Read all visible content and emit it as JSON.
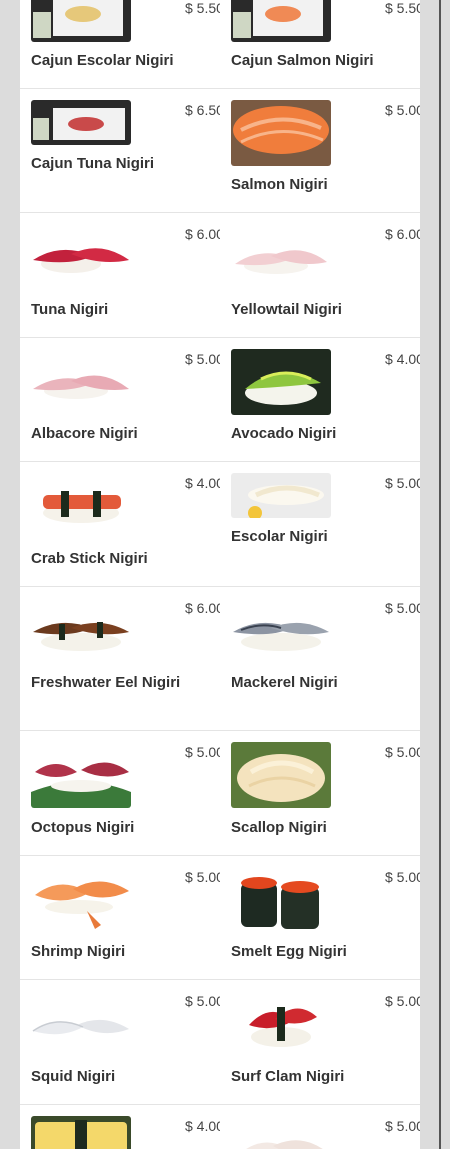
{
  "menu": {
    "items": [
      {
        "name": "Cajun Escolar Nigiri",
        "price": "$ 5.50",
        "image": "cajun-escolar-photo-icon"
      },
      {
        "name": "Cajun Salmon Nigiri",
        "price": "$ 5.50",
        "image": "cajun-salmon-photo-icon"
      },
      {
        "name": "Cajun Tuna Nigiri",
        "price": "$ 6.50",
        "image": "cajun-tuna-photo-icon"
      },
      {
        "name": "Salmon Nigiri",
        "price": "$ 5.00",
        "image": "salmon-photo-icon"
      },
      {
        "name": "Tuna Nigiri",
        "price": "$ 6.00",
        "image": "tuna-photo-icon"
      },
      {
        "name": "Yellowtail Nigiri",
        "price": "$ 6.00",
        "image": "yellowtail-photo-icon"
      },
      {
        "name": "Albacore Nigiri",
        "price": "$ 5.00",
        "image": "albacore-photo-icon"
      },
      {
        "name": "Avocado Nigiri",
        "price": "$ 4.00",
        "image": "avocado-photo-icon"
      },
      {
        "name": "Crab Stick Nigiri",
        "price": "$ 4.00",
        "image": "crab-stick-photo-icon"
      },
      {
        "name": "Escolar Nigiri",
        "price": "$ 5.00",
        "image": "escolar-photo-icon"
      },
      {
        "name": "Freshwater Eel Nigiri",
        "price": "$ 6.00",
        "image": "eel-photo-icon"
      },
      {
        "name": "Mackerel Nigiri",
        "price": "$ 5.00",
        "image": "mackerel-photo-icon"
      },
      {
        "name": "Octopus Nigiri",
        "price": "$ 5.00",
        "image": "octopus-photo-icon"
      },
      {
        "name": "Scallop Nigiri",
        "price": "$ 5.00",
        "image": "scallop-photo-icon"
      },
      {
        "name": "Shrimp Nigiri",
        "price": "$ 5.00",
        "image": "shrimp-photo-icon"
      },
      {
        "name": "Smelt Egg Nigiri",
        "price": "$ 5.00",
        "image": "smelt-egg-photo-icon"
      },
      {
        "name": "Squid Nigiri",
        "price": "$ 5.00",
        "image": "squid-photo-icon"
      },
      {
        "name": "Surf Clam Nigiri",
        "price": "$ 5.00",
        "image": "surf-clam-photo-icon"
      },
      {
        "name": "",
        "price": "$ 4.00",
        "image": "tamago-photo-icon"
      },
      {
        "name": "",
        "price": "$ 5.00",
        "image": "nigiri-photo-icon"
      }
    ]
  }
}
